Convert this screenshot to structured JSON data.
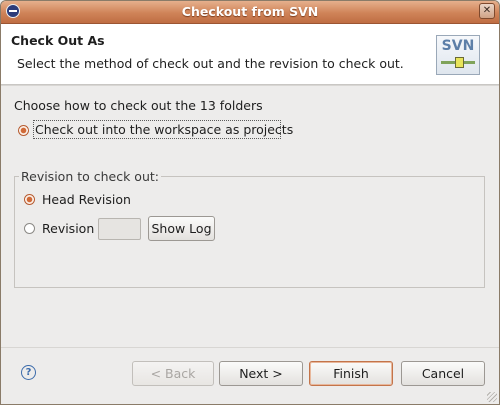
{
  "window": {
    "title": "Checkout from SVN",
    "close_icon_glyph": "✕"
  },
  "banner": {
    "heading": "Check Out As",
    "description": "Select the method of check out and the revision to check out.",
    "logo_text": "SVN"
  },
  "method": {
    "prompt": "Choose how to check out the 13 folders",
    "option_label": "Check out into the workspace as projects",
    "selected": true
  },
  "revision": {
    "group_title": "Revision to check out:",
    "head_label": "Head Revision",
    "head_selected": true,
    "revision_label": "Revision",
    "revision_value": "",
    "show_log_label": "Show Log"
  },
  "footer": {
    "help_glyph": "?",
    "back_label": "< Back",
    "next_label": "Next >",
    "finish_label": "Finish",
    "cancel_label": "Cancel"
  },
  "colors": {
    "titlebar": "#cf8358",
    "radio_selected": "#d06a38",
    "window_bg": "#edeceb"
  }
}
